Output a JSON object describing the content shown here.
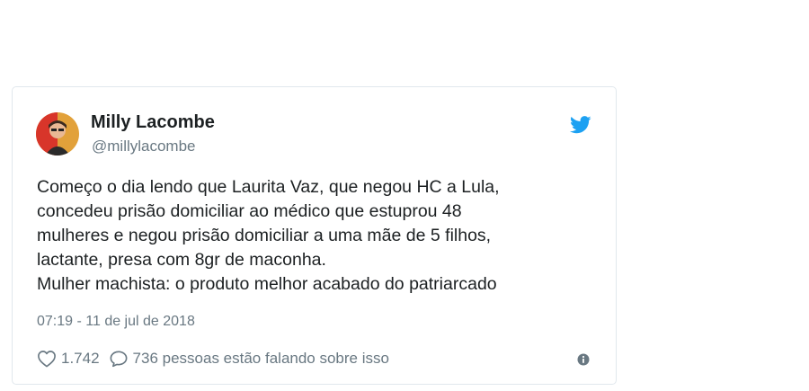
{
  "tweet": {
    "author_name": "Milly Lacombe",
    "author_handle": "@millylacombe",
    "text_lines": [
      "Começo o dia lendo que Laurita Vaz, que negou HC a Lula,",
      "concedeu prisão domiciliar ao médico que estuprou 48",
      "mulheres e negou prisão domiciliar a uma mãe de 5 filhos,",
      "lactante, presa com 8gr de maconha.",
      "Mulher machista: o produto melhor acabado do patriarcado"
    ],
    "timestamp": "07:19 - 11 de jul de 2018",
    "likes": "1.742",
    "replies_text": "736 pessoas estão falando sobre isso"
  },
  "icons": {
    "brand": "twitter-bird-icon",
    "like": "heart-icon",
    "reply": "speech-bubble-icon",
    "info": "info-icon"
  },
  "colors": {
    "brand": "#1da1f2",
    "secondary_text": "#697882",
    "card_border": "#e1e8ed"
  }
}
